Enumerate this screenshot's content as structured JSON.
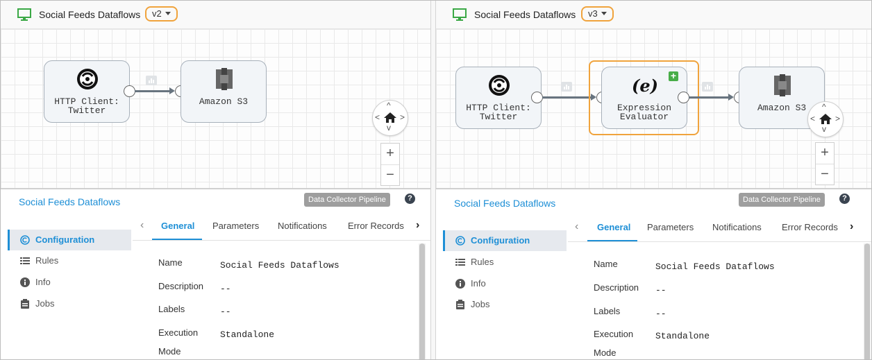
{
  "panels": [
    {
      "id": "v2",
      "pipeline_title": "Social Feeds Dataflows",
      "version": "v2",
      "stages": [
        {
          "label": "HTTP Client:\nTwitter",
          "icon": "http-client-sync-icon"
        },
        {
          "label": "Amazon S3",
          "icon": "amazon-s3-icon"
        }
      ],
      "config": {
        "title": "Social Feeds Dataflows",
        "type_badge": "Data Collector Pipeline",
        "help": "?",
        "nav": [
          "Configuration",
          "Rules",
          "Info",
          "Jobs"
        ],
        "tabs": [
          "General",
          "Parameters",
          "Notifications",
          "Error Records"
        ],
        "properties": [
          {
            "label": "Name",
            "value": "Social Feeds Dataflows"
          },
          {
            "label": "Description",
            "value": "--"
          },
          {
            "label": "Labels",
            "value": "--"
          },
          {
            "label": "Execution\nMode",
            "value": "Standalone"
          }
        ]
      }
    },
    {
      "id": "v3",
      "pipeline_title": "Social Feeds Dataflows",
      "version": "v3",
      "stages": [
        {
          "label": "HTTP Client:\nTwitter",
          "icon": "http-client-sync-icon"
        },
        {
          "label": "Expression\nEvaluator",
          "icon": "expression-evaluator-icon",
          "added": true
        },
        {
          "label": "Amazon S3",
          "icon": "amazon-s3-icon"
        }
      ],
      "config": {
        "title": "Social Feeds Dataflows",
        "type_badge": "Data Collector Pipeline",
        "help": "?",
        "nav": [
          "Configuration",
          "Rules",
          "Info",
          "Jobs"
        ],
        "tabs": [
          "General",
          "Parameters",
          "Notifications",
          "Error Records"
        ],
        "properties": [
          {
            "label": "Name",
            "value": "Social Feeds Dataflows"
          },
          {
            "label": "Description",
            "value": "--"
          },
          {
            "label": "Labels",
            "value": "--"
          },
          {
            "label": "Execution\nMode",
            "value": "Standalone"
          }
        ]
      }
    }
  ],
  "controls": {
    "zoom_in": "+",
    "zoom_out": "−",
    "tab_prev": "‹",
    "tab_next": "›",
    "version_icon": "caret-down-icon"
  },
  "colors": {
    "accent": "#1e8fd6",
    "highlight": "#f0a33c",
    "added": "#48ad48",
    "monitor": "#3aa845"
  }
}
